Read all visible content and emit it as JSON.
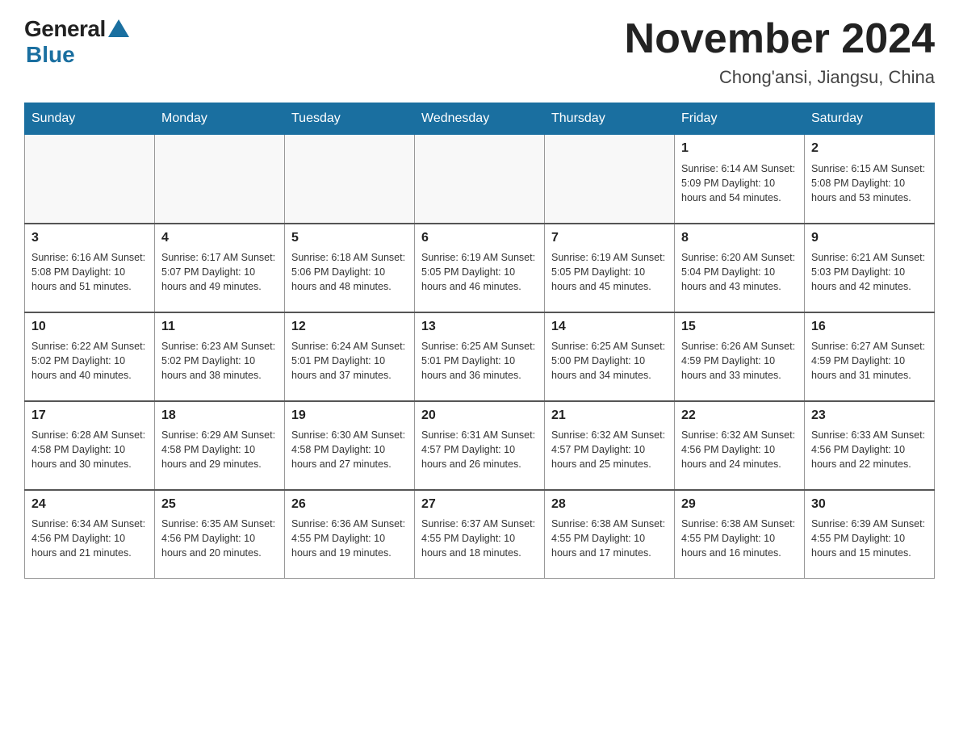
{
  "header": {
    "logo_general": "General",
    "logo_blue": "Blue",
    "title": "November 2024",
    "subtitle": "Chong'ansi, Jiangsu, China"
  },
  "weekdays": [
    "Sunday",
    "Monday",
    "Tuesday",
    "Wednesday",
    "Thursday",
    "Friday",
    "Saturday"
  ],
  "weeks": [
    [
      {
        "day": "",
        "info": ""
      },
      {
        "day": "",
        "info": ""
      },
      {
        "day": "",
        "info": ""
      },
      {
        "day": "",
        "info": ""
      },
      {
        "day": "",
        "info": ""
      },
      {
        "day": "1",
        "info": "Sunrise: 6:14 AM\nSunset: 5:09 PM\nDaylight: 10 hours and 54 minutes."
      },
      {
        "day": "2",
        "info": "Sunrise: 6:15 AM\nSunset: 5:08 PM\nDaylight: 10 hours and 53 minutes."
      }
    ],
    [
      {
        "day": "3",
        "info": "Sunrise: 6:16 AM\nSunset: 5:08 PM\nDaylight: 10 hours and 51 minutes."
      },
      {
        "day": "4",
        "info": "Sunrise: 6:17 AM\nSunset: 5:07 PM\nDaylight: 10 hours and 49 minutes."
      },
      {
        "day": "5",
        "info": "Sunrise: 6:18 AM\nSunset: 5:06 PM\nDaylight: 10 hours and 48 minutes."
      },
      {
        "day": "6",
        "info": "Sunrise: 6:19 AM\nSunset: 5:05 PM\nDaylight: 10 hours and 46 minutes."
      },
      {
        "day": "7",
        "info": "Sunrise: 6:19 AM\nSunset: 5:05 PM\nDaylight: 10 hours and 45 minutes."
      },
      {
        "day": "8",
        "info": "Sunrise: 6:20 AM\nSunset: 5:04 PM\nDaylight: 10 hours and 43 minutes."
      },
      {
        "day": "9",
        "info": "Sunrise: 6:21 AM\nSunset: 5:03 PM\nDaylight: 10 hours and 42 minutes."
      }
    ],
    [
      {
        "day": "10",
        "info": "Sunrise: 6:22 AM\nSunset: 5:02 PM\nDaylight: 10 hours and 40 minutes."
      },
      {
        "day": "11",
        "info": "Sunrise: 6:23 AM\nSunset: 5:02 PM\nDaylight: 10 hours and 38 minutes."
      },
      {
        "day": "12",
        "info": "Sunrise: 6:24 AM\nSunset: 5:01 PM\nDaylight: 10 hours and 37 minutes."
      },
      {
        "day": "13",
        "info": "Sunrise: 6:25 AM\nSunset: 5:01 PM\nDaylight: 10 hours and 36 minutes."
      },
      {
        "day": "14",
        "info": "Sunrise: 6:25 AM\nSunset: 5:00 PM\nDaylight: 10 hours and 34 minutes."
      },
      {
        "day": "15",
        "info": "Sunrise: 6:26 AM\nSunset: 4:59 PM\nDaylight: 10 hours and 33 minutes."
      },
      {
        "day": "16",
        "info": "Sunrise: 6:27 AM\nSunset: 4:59 PM\nDaylight: 10 hours and 31 minutes."
      }
    ],
    [
      {
        "day": "17",
        "info": "Sunrise: 6:28 AM\nSunset: 4:58 PM\nDaylight: 10 hours and 30 minutes."
      },
      {
        "day": "18",
        "info": "Sunrise: 6:29 AM\nSunset: 4:58 PM\nDaylight: 10 hours and 29 minutes."
      },
      {
        "day": "19",
        "info": "Sunrise: 6:30 AM\nSunset: 4:58 PM\nDaylight: 10 hours and 27 minutes."
      },
      {
        "day": "20",
        "info": "Sunrise: 6:31 AM\nSunset: 4:57 PM\nDaylight: 10 hours and 26 minutes."
      },
      {
        "day": "21",
        "info": "Sunrise: 6:32 AM\nSunset: 4:57 PM\nDaylight: 10 hours and 25 minutes."
      },
      {
        "day": "22",
        "info": "Sunrise: 6:32 AM\nSunset: 4:56 PM\nDaylight: 10 hours and 24 minutes."
      },
      {
        "day": "23",
        "info": "Sunrise: 6:33 AM\nSunset: 4:56 PM\nDaylight: 10 hours and 22 minutes."
      }
    ],
    [
      {
        "day": "24",
        "info": "Sunrise: 6:34 AM\nSunset: 4:56 PM\nDaylight: 10 hours and 21 minutes."
      },
      {
        "day": "25",
        "info": "Sunrise: 6:35 AM\nSunset: 4:56 PM\nDaylight: 10 hours and 20 minutes."
      },
      {
        "day": "26",
        "info": "Sunrise: 6:36 AM\nSunset: 4:55 PM\nDaylight: 10 hours and 19 minutes."
      },
      {
        "day": "27",
        "info": "Sunrise: 6:37 AM\nSunset: 4:55 PM\nDaylight: 10 hours and 18 minutes."
      },
      {
        "day": "28",
        "info": "Sunrise: 6:38 AM\nSunset: 4:55 PM\nDaylight: 10 hours and 17 minutes."
      },
      {
        "day": "29",
        "info": "Sunrise: 6:38 AM\nSunset: 4:55 PM\nDaylight: 10 hours and 16 minutes."
      },
      {
        "day": "30",
        "info": "Sunrise: 6:39 AM\nSunset: 4:55 PM\nDaylight: 10 hours and 15 minutes."
      }
    ]
  ]
}
